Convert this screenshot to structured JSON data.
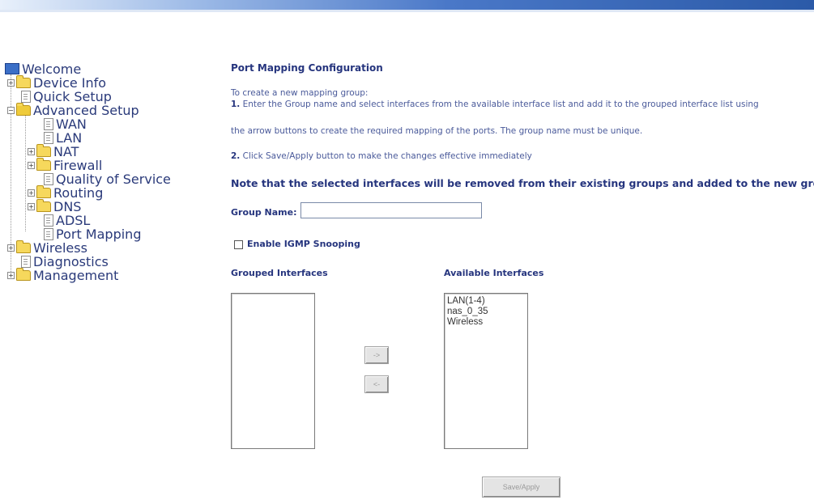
{
  "sidebar": {
    "items": [
      {
        "label": "Welcome"
      },
      {
        "label": "Device Info"
      },
      {
        "label": "Quick Setup"
      },
      {
        "label": "Advanced Setup"
      },
      {
        "label": "WAN"
      },
      {
        "label": "LAN"
      },
      {
        "label": "NAT"
      },
      {
        "label": "Firewall"
      },
      {
        "label": "Quality of Service"
      },
      {
        "label": "Routing"
      },
      {
        "label": "DNS"
      },
      {
        "label": "ADSL"
      },
      {
        "label": "Port Mapping"
      },
      {
        "label": "Wireless"
      },
      {
        "label": "Diagnostics"
      },
      {
        "label": "Management"
      }
    ]
  },
  "main": {
    "title": "Port Mapping Configuration",
    "intro": "To create a new mapping group:",
    "step1_num": "1.",
    "step1": "Enter the Group name and select interfaces from the available interface list and add it to the grouped interface list using",
    "step1b": "the arrow buttons to create the required mapping of the ports. The group name must be unique.",
    "step2_num": "2.",
    "step2": "Click Save/Apply button to make the changes effective immediately",
    "note": "Note that the selected interfaces will be removed from their existing groups and added to the new group.",
    "group_name_label": "Group Name:",
    "group_name_value": "",
    "igmp_label": "Enable IGMP Snooping",
    "grouped_label": "Grouped Interfaces",
    "available_label": "Available Interfaces",
    "available_options": [
      "LAN(1-4)",
      "nas_0_35",
      "Wireless"
    ],
    "add_button": "->",
    "remove_button": "<-",
    "save_button": "Save/Apply"
  }
}
